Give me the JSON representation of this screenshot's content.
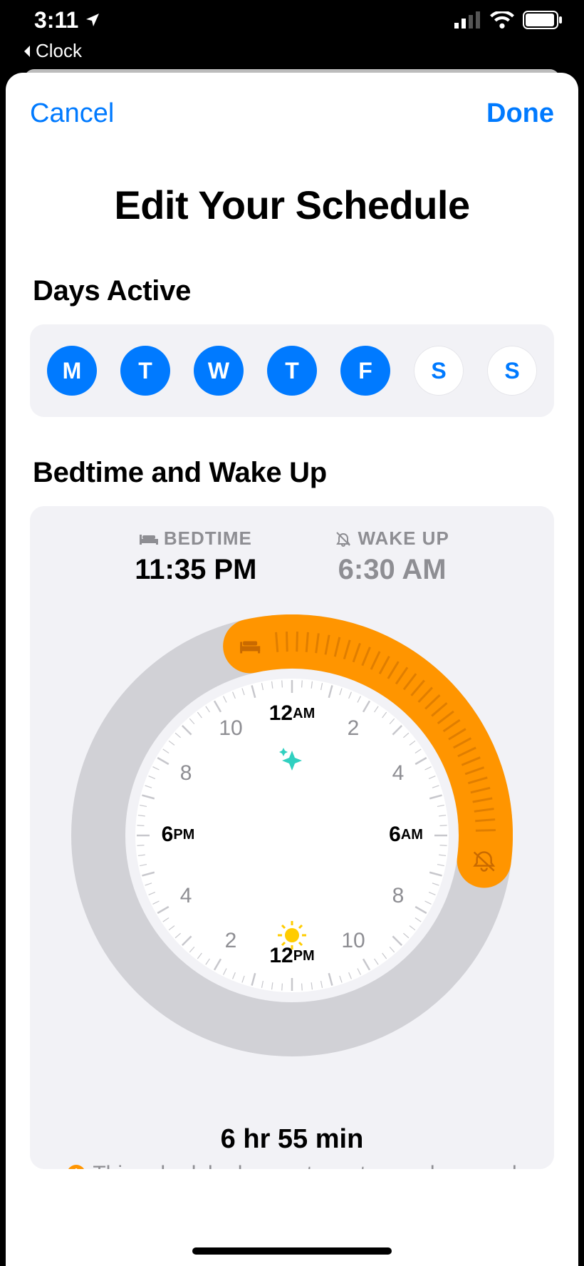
{
  "status": {
    "time": "3:11",
    "back_app": "Clock"
  },
  "nav": {
    "cancel": "Cancel",
    "done": "Done"
  },
  "title": "Edit Your Schedule",
  "sections": {
    "days_label": "Days Active",
    "bedtime_label": "Bedtime and Wake Up"
  },
  "days": [
    {
      "label": "M",
      "active": true
    },
    {
      "label": "T",
      "active": true
    },
    {
      "label": "W",
      "active": true
    },
    {
      "label": "T",
      "active": true
    },
    {
      "label": "F",
      "active": true
    },
    {
      "label": "S",
      "active": false
    },
    {
      "label": "S",
      "active": false
    }
  ],
  "bedtime": {
    "heading": "BEDTIME",
    "value": "11:35 PM"
  },
  "wakeup": {
    "heading": "WAKE UP",
    "value": "6:30 AM"
  },
  "clock_labels": {
    "top": "12AM",
    "bottom": "12PM",
    "left": "6PM",
    "right": "6AM",
    "n2": "2",
    "n4": "4",
    "n8": "8",
    "n10": "10",
    "s2": "2",
    "s4": "4",
    "s8": "8",
    "s10": "10"
  },
  "duration": "6 hr 55 min",
  "warning": "This schedule does not meet your sleep goal",
  "arc": {
    "start_deg": -12.5,
    "end_deg": 97.5
  },
  "colors": {
    "accent_orange": "#ff9500",
    "tint_blue": "#007aff",
    "grey": "#8e8e93",
    "ring": "#d1d1d6"
  }
}
